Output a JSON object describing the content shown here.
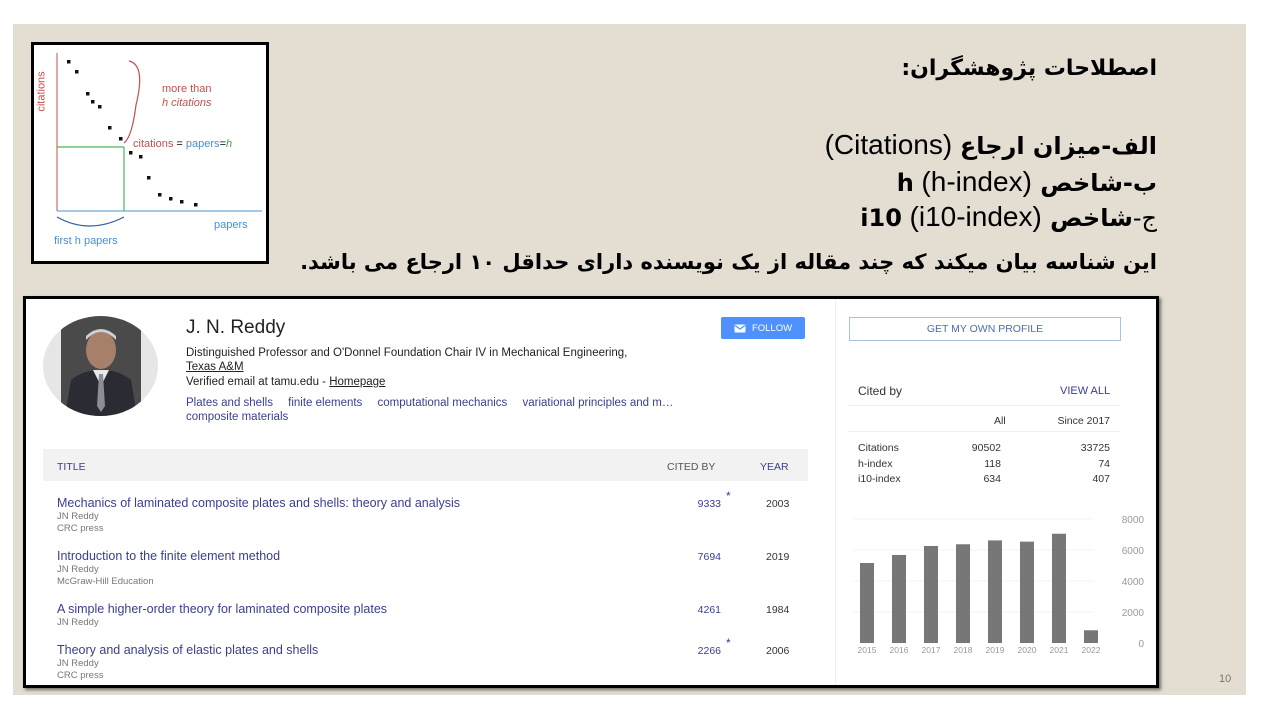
{
  "slide": {
    "page_number": "10",
    "background_color": "#e3ddd2",
    "persian": {
      "title": "اصطلاحات پژوهشگران:",
      "items": [
        {
          "prefix": "الف-",
          "term": "میزان ارجاع",
          "english": "(Citations)"
        },
        {
          "prefix": "ب-",
          "term": "شاخص h",
          "english": "(h-index)"
        },
        {
          "prefix": "ج-",
          "term": "شاخص i10",
          "english": "(i10-index)"
        }
      ],
      "description": "این شناسه بیان میکند که چند مقاله از یک نویسنده دارای حداقل ۱۰ ارجاع می باشد."
    }
  },
  "h_index_figure": {
    "y_axis_label": "citations",
    "x_axis_label": "papers",
    "brace_label_line1": "more than",
    "brace_label_line2": "h citations",
    "equation_part1": "citations",
    "equation_eq1": "=",
    "equation_part2": "papers",
    "equation_eq2": "=",
    "equation_part3": "h",
    "bottom_label": "first h papers",
    "colors": {
      "citations": "#c0504d",
      "papers": "#4a90c8",
      "h": "#3aa84a"
    }
  },
  "profile": {
    "name": "J. N. Reddy",
    "affiliation": "Distinguished Professor and O'Donnel Foundation Chair IV in Mechanical Engineering,",
    "institution": "Texas A&M",
    "verified_email": "Verified email at tamu.edu - ",
    "homepage_label": "Homepage",
    "interests": [
      "Plates and shells",
      "finite elements",
      "computational mechanics",
      "variational principles and m…",
      "composite materials"
    ],
    "follow_label": "FOLLOW",
    "accent_color": "#4d90fe"
  },
  "articles_table": {
    "headers": {
      "title": "TITLE",
      "cited_by": "CITED BY",
      "year": "YEAR"
    },
    "rows": [
      {
        "title": "Mechanics of laminated composite plates and shells: theory and analysis",
        "authors": "JN Reddy",
        "venue": "CRC press",
        "cited_by": "9333",
        "star": "*",
        "year": "2003"
      },
      {
        "title": "Introduction to the finite element method",
        "authors": "JN Reddy",
        "venue": "McGraw-Hill Education",
        "cited_by": "7694",
        "star": "",
        "year": "2019"
      },
      {
        "title": "A simple higher-order theory for laminated composite plates",
        "authors": "JN Reddy",
        "venue": "",
        "cited_by": "4261",
        "star": "",
        "year": "1984"
      },
      {
        "title": "Theory and analysis of elastic plates and shells",
        "authors": "JN Reddy",
        "venue": "CRC press",
        "cited_by": "2266",
        "star": "*",
        "year": "2006"
      }
    ]
  },
  "sidebar": {
    "get_profile_label": "GET MY OWN PROFILE",
    "cited_by_title": "Cited by",
    "view_all_label": "VIEW ALL",
    "columns": [
      "All",
      "Since 2017"
    ],
    "metrics": [
      {
        "label": "Citations",
        "all": "90502",
        "since": "33725"
      },
      {
        "label": "h-index",
        "all": "118",
        "since": "74"
      },
      {
        "label": "i10-index",
        "all": "634",
        "since": "407"
      }
    ]
  },
  "chart_data": {
    "type": "bar",
    "title": "",
    "xlabel": "",
    "ylabel": "",
    "categories": [
      "2015",
      "2016",
      "2017",
      "2018",
      "2019",
      "2020",
      "2021",
      "2022"
    ],
    "values": [
      5160,
      5680,
      6260,
      6370,
      6620,
      6540,
      7050,
      820
    ],
    "ylim": [
      0,
      8000
    ],
    "yticks": [
      "0",
      "2000",
      "4000",
      "6000",
      "8000"
    ],
    "y_axis_side": "right",
    "grid": true,
    "bar_color": "#777777"
  }
}
